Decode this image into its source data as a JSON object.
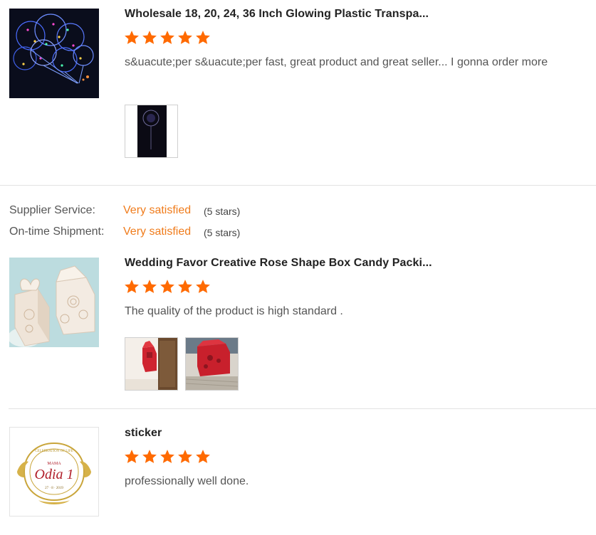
{
  "colors": {
    "star": "#ff6a00",
    "satisfied": "#f07c1c",
    "divider": "#e2e2e2"
  },
  "reviews": [
    {
      "title": "Wholesale 18, 20, 24, 36 Inch Glowing Plastic Transpa...",
      "stars": 5,
      "text": "s&uacute;per s&uacute;per fast, great product and great seller... I gonna order more"
    },
    {
      "title": "Wedding Favor Creative Rose Shape Box Candy Packi...",
      "stars": 5,
      "text": "The quality of the product is high standard ."
    },
    {
      "title": "sticker",
      "stars": 5,
      "text": "professionally well done.",
      "logo": {
        "top": "CELEBRATION OF LIFE",
        "small": "MAMA",
        "name": "Odia 1",
        "date": "27 · 8 · 2019"
      }
    }
  ],
  "seller_ratings": [
    {
      "label": "Supplier Service:",
      "value": "Very satisfied",
      "stars": "(5 stars)"
    },
    {
      "label": "On-time Shipment:",
      "value": "Very satisfied",
      "stars": "(5 stars)"
    }
  ]
}
